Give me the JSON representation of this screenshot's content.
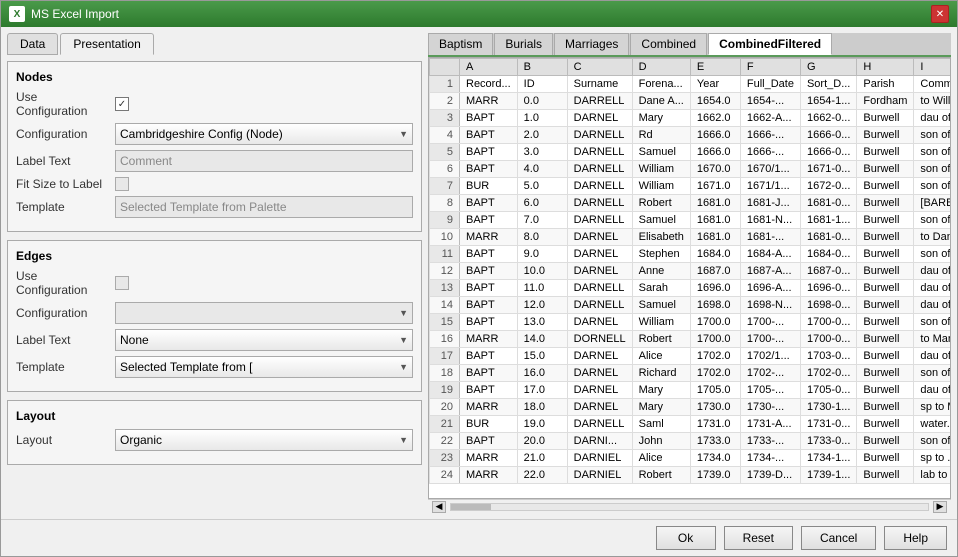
{
  "window": {
    "title": "MS Excel Import",
    "close_label": "✕"
  },
  "tabs": {
    "data_label": "Data",
    "presentation_label": "Presentation"
  },
  "nodes": {
    "section_title": "Nodes",
    "use_config_label": "Use Configuration",
    "use_config_checked": true,
    "config_label": "Configuration",
    "config_value": "Cambridgeshire Config (Node)",
    "label_text_label": "Label Text",
    "label_text_value": "Comment",
    "fit_size_label": "Fit Size to Label",
    "template_label": "Template",
    "template_value": "Selected Template from Palette"
  },
  "edges": {
    "section_title": "Edges",
    "use_config_label": "Use Configuration",
    "use_config_checked": false,
    "config_label": "Configuration",
    "config_value": "",
    "label_text_label": "Label Text",
    "label_text_value": "None",
    "template_label": "Template",
    "template_value": "Selected Template from ["
  },
  "layout": {
    "section_title": "Layout",
    "layout_label": "Layout",
    "layout_value": "Organic"
  },
  "data_tabs": [
    {
      "label": "Baptism",
      "active": false
    },
    {
      "label": "Burials",
      "active": false
    },
    {
      "label": "Marriages",
      "active": false
    },
    {
      "label": "Combined",
      "active": false
    },
    {
      "label": "CombinedFiltered",
      "active": true
    }
  ],
  "table": {
    "col_headers": [
      "",
      "A",
      "B",
      "C",
      "D",
      "E",
      "F",
      "G",
      "H",
      "I"
    ],
    "rows": [
      [
        "1",
        "Record...",
        "ID",
        "Surname",
        "Forena...",
        "Year",
        "Full_Date",
        "Sort_D...",
        "Parish",
        "Commer"
      ],
      [
        "2",
        "MARR",
        "0.0",
        "DARRELL",
        "Dane A...",
        "1654.0",
        "1654-...",
        "1654-1...",
        "Fordham",
        "to Willi..."
      ],
      [
        "3",
        "BAPT",
        "1.0",
        "DARNEL",
        "Mary",
        "1662.0",
        "1662-A...",
        "1662-0...",
        "Burwell",
        "dau of ..."
      ],
      [
        "4",
        "BAPT",
        "2.0",
        "DARNELL",
        "Rd",
        "1666.0",
        "1666-...",
        "1666-0...",
        "Burwell",
        "son of ..."
      ],
      [
        "5",
        "BAPT",
        "3.0",
        "DARNELL",
        "Samuel",
        "1666.0",
        "1666-...",
        "1666-0...",
        "Burwell",
        "son of ..."
      ],
      [
        "6",
        "BAPT",
        "4.0",
        "DARNELL",
        "William",
        "1670.0",
        "1670/1...",
        "1671-0...",
        "Burwell",
        "son of ..."
      ],
      [
        "7",
        "BUR",
        "5.0",
        "DARNELL",
        "William",
        "1671.0",
        "1671/1...",
        "1672-0...",
        "Burwell",
        "son of ..."
      ],
      [
        "8",
        "BAPT",
        "6.0",
        "DARNELL",
        "Robert",
        "1681.0",
        "1681-J...",
        "1681-0...",
        "Burwell",
        "[BARBI..."
      ],
      [
        "9",
        "BAPT",
        "7.0",
        "DARNELL",
        "Samuel",
        "1681.0",
        "1681-N...",
        "1681-1...",
        "Burwell",
        "son of ..."
      ],
      [
        "10",
        "MARR",
        "8.0",
        "DARNEL",
        "Elisabeth",
        "1681.0",
        "1681-...",
        "1681-0...",
        "Burwell",
        "to Dani..."
      ],
      [
        "11",
        "BAPT",
        "9.0",
        "DARNEL",
        "Stephen",
        "1684.0",
        "1684-A...",
        "1684-0...",
        "Burwell",
        "son of ..."
      ],
      [
        "12",
        "BAPT",
        "10.0",
        "DARNEL",
        "Anne",
        "1687.0",
        "1687-A...",
        "1687-0...",
        "Burwell",
        "dau of ..."
      ],
      [
        "13",
        "BAPT",
        "11.0",
        "DARNELL",
        "Sarah",
        "1696.0",
        "1696-A...",
        "1696-0...",
        "Burwell",
        "dau of ..."
      ],
      [
        "14",
        "BAPT",
        "12.0",
        "DARNELL",
        "Samuel",
        "1698.0",
        "1698-N...",
        "1698-0...",
        "Burwell",
        "dau of ..."
      ],
      [
        "15",
        "BAPT",
        "13.0",
        "DARNEL",
        "William",
        "1700.0",
        "1700-...",
        "1700-0...",
        "Burwell",
        "son of ..."
      ],
      [
        "16",
        "MARR",
        "14.0",
        "DORNELL",
        "Robert",
        "1700.0",
        "1700-...",
        "1700-0...",
        "Burwell",
        "to Mar..."
      ],
      [
        "17",
        "BAPT",
        "15.0",
        "DARNEL",
        "Alice",
        "1702.0",
        "1702/1...",
        "1703-0...",
        "Burwell",
        "dau of ..."
      ],
      [
        "18",
        "BAPT",
        "16.0",
        "DARNEL",
        "Richard",
        "1702.0",
        "1702-...",
        "1702-0...",
        "Burwell",
        "son of ..."
      ],
      [
        "19",
        "BAPT",
        "17.0",
        "DARNEL",
        "Mary",
        "1705.0",
        "1705-...",
        "1705-0...",
        "Burwell",
        "dau of ..."
      ],
      [
        "20",
        "MARR",
        "18.0",
        "DARNEL",
        "Mary",
        "1730.0",
        "1730-...",
        "1730-1...",
        "Burwell",
        "sp to M..."
      ],
      [
        "21",
        "BUR",
        "19.0",
        "DARNELL",
        "Saml",
        "1731.0",
        "1731-A...",
        "1731-0...",
        "Burwell",
        "water..."
      ],
      [
        "22",
        "BAPT",
        "20.0",
        "DARNI...",
        "John",
        "1733.0",
        "1733-...",
        "1733-0...",
        "Burwell",
        "son of ..."
      ],
      [
        "23",
        "MARR",
        "21.0",
        "DARNIEL",
        "Alice",
        "1734.0",
        "1734-...",
        "1734-1...",
        "Burwell",
        "sp to ..."
      ],
      [
        "24",
        "MARR",
        "22.0",
        "DARNIEL",
        "Robert",
        "1739.0",
        "1739-D...",
        "1739-1...",
        "Burwell",
        "lab to ..."
      ]
    ]
  },
  "buttons": {
    "ok_label": "Ok",
    "reset_label": "Reset",
    "cancel_label": "Cancel",
    "help_label": "Help"
  }
}
